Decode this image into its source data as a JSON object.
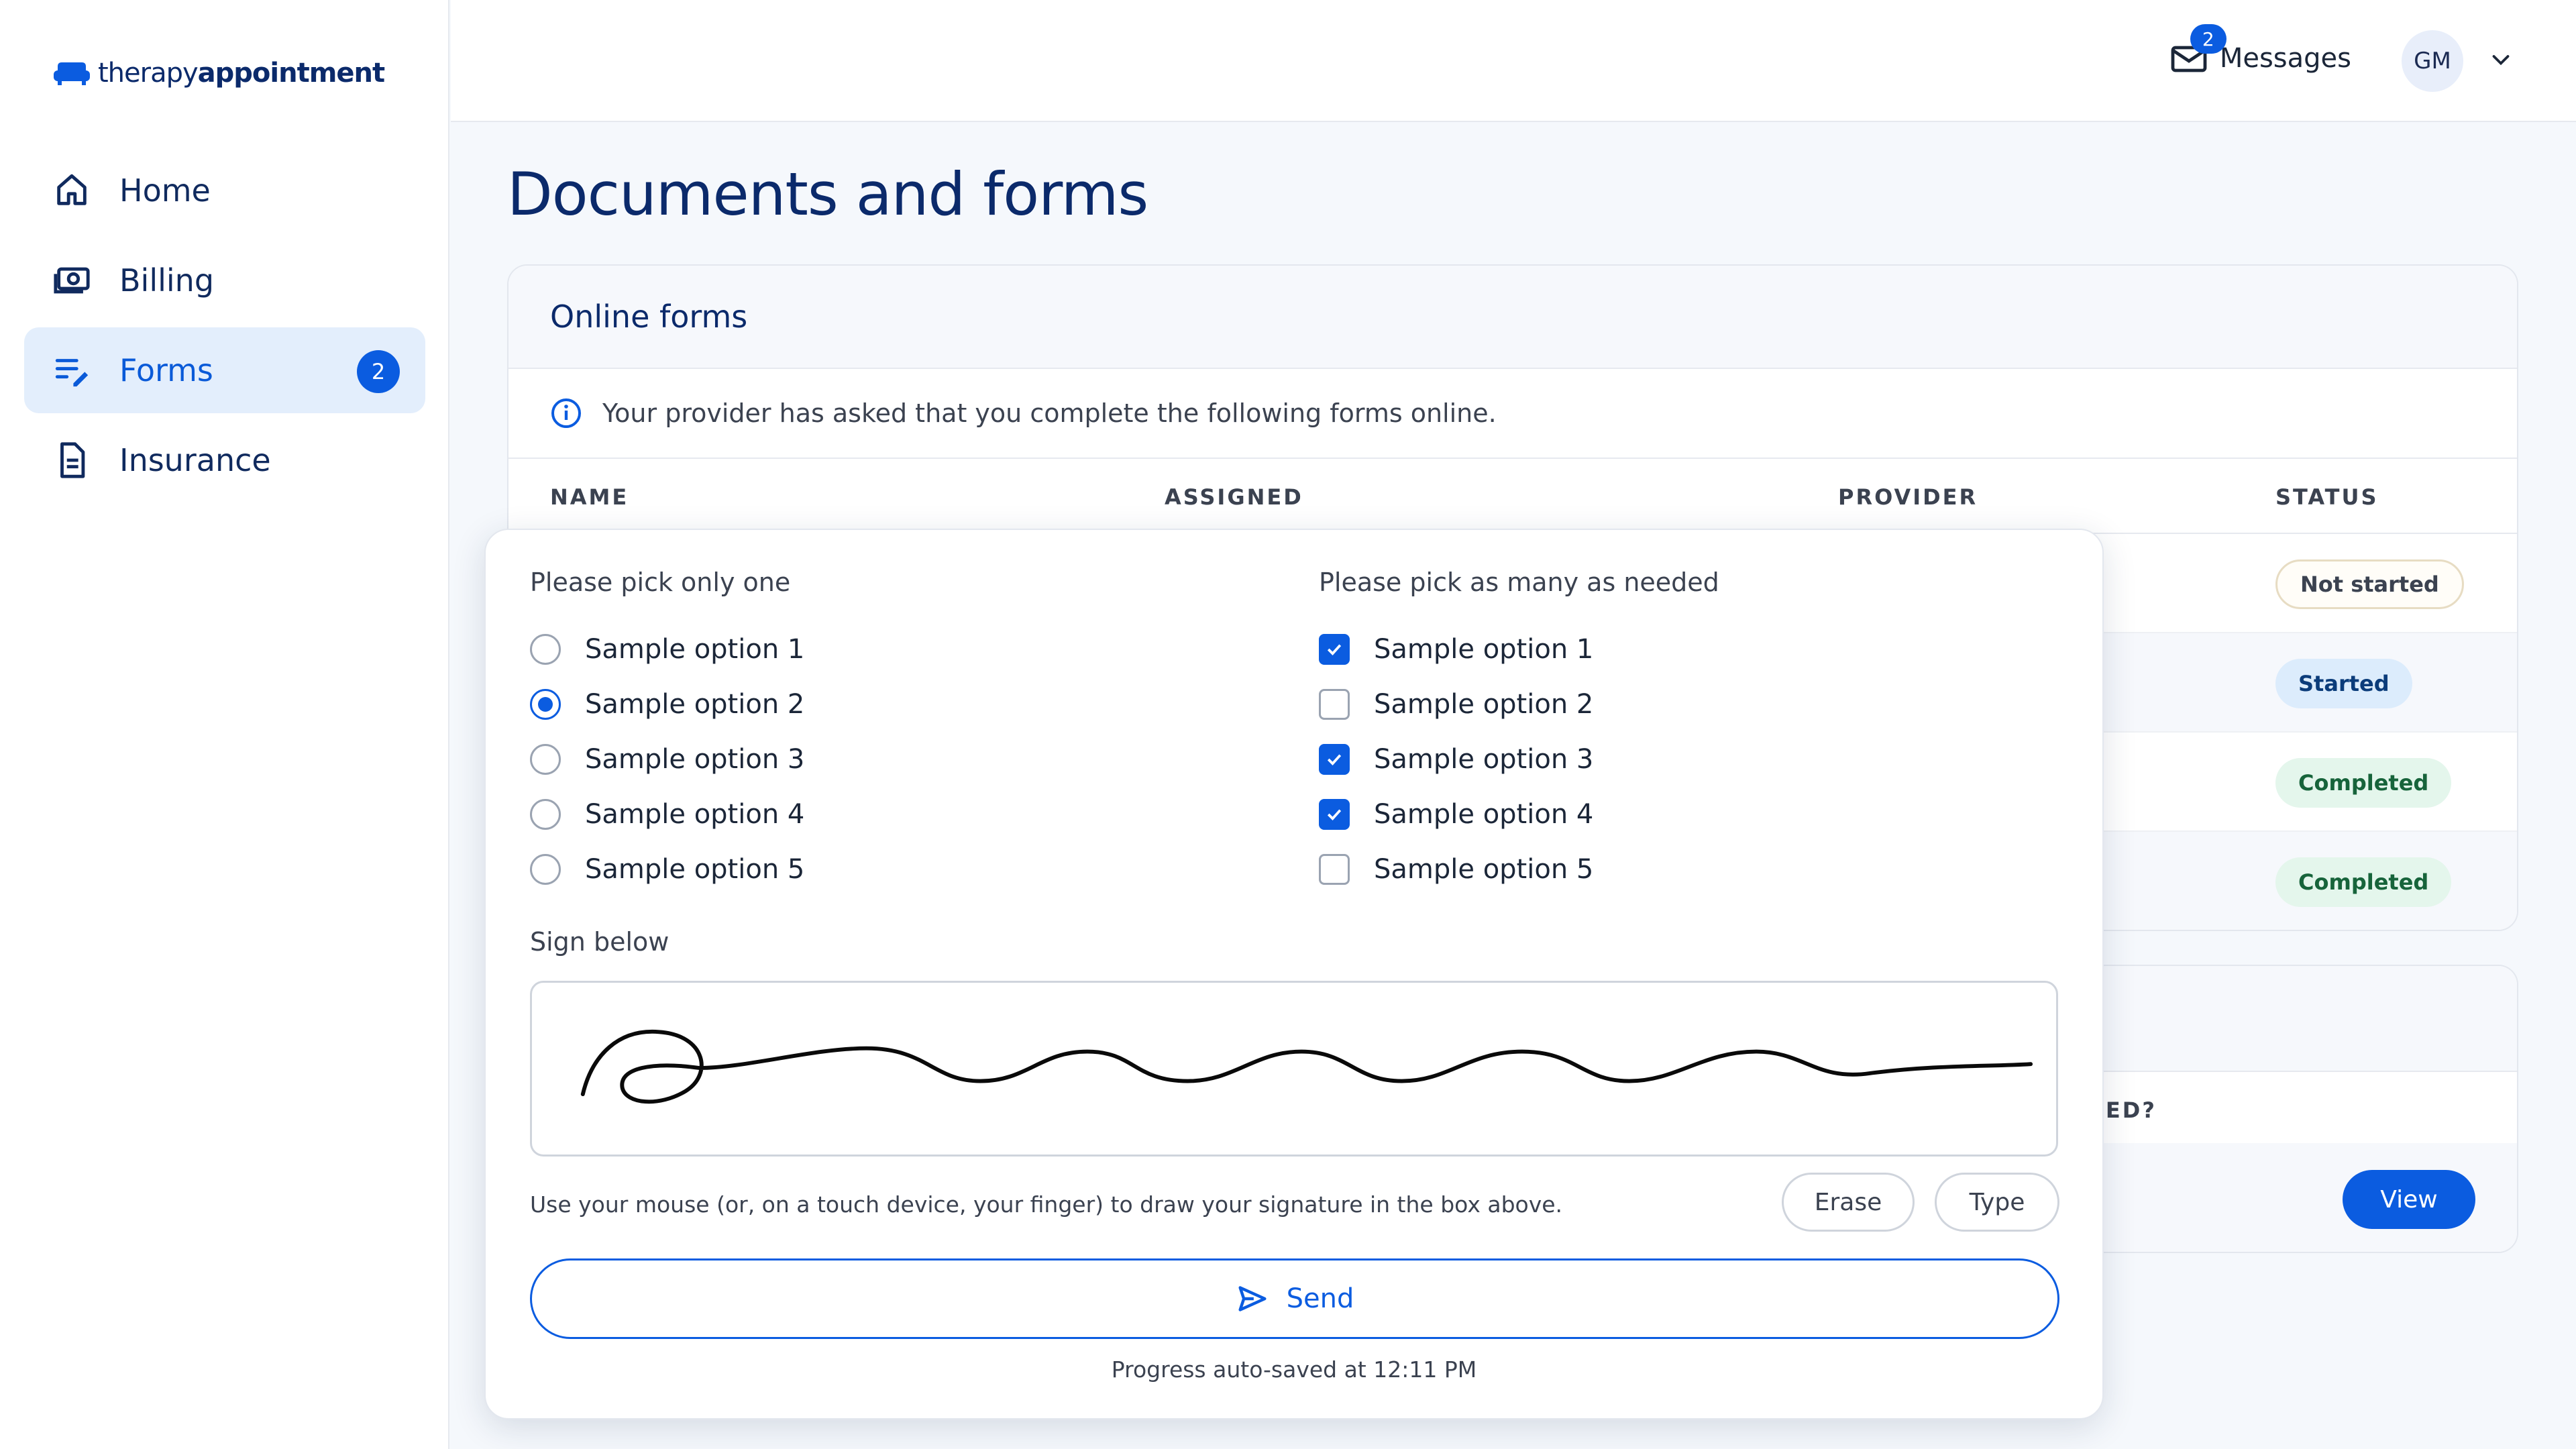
{
  "brand": {
    "logo_light": "therapy",
    "logo_bold": "appointment",
    "accent": "#0b5ce0",
    "navy": "#0b2a6b"
  },
  "sidebar": {
    "items": [
      {
        "label": "Home",
        "icon": "home-icon"
      },
      {
        "label": "Billing",
        "icon": "billing-icon"
      },
      {
        "label": "Forms",
        "icon": "forms-icon",
        "badge": "2",
        "active": true
      },
      {
        "label": "Insurance",
        "icon": "document-icon"
      }
    ]
  },
  "header": {
    "messages_label": "Messages",
    "messages_badge": "2",
    "avatar_initials": "GM"
  },
  "page": {
    "title": "Documents and forms"
  },
  "online_forms": {
    "title": "Online forms",
    "info": "Your provider has asked that you complete the following forms online.",
    "columns": [
      "NAME",
      "ASSIGNED",
      "PROVIDER",
      "STATUS"
    ],
    "statuses": [
      "Not started",
      "Started",
      "Completed",
      "Completed"
    ]
  },
  "documents": {
    "partial_header": "IED?",
    "view_label": "View"
  },
  "modal": {
    "radio_question": "Please pick only one",
    "radio_options": [
      "Sample option 1",
      "Sample option 2",
      "Sample option 3",
      "Sample option 4",
      "Sample option 5"
    ],
    "radio_selected_index": 1,
    "check_question": "Please pick as many as needed",
    "check_options": [
      "Sample option 1",
      "Sample option 2",
      "Sample option 3",
      "Sample option 4",
      "Sample option 5"
    ],
    "check_checked": [
      true,
      false,
      true,
      true,
      false
    ],
    "sign_label": "Sign below",
    "sign_hint": "Use your mouse (or, on a touch device, your finger) to draw your signature in the box above.",
    "erase_label": "Erase",
    "type_label": "Type",
    "send_label": "Send",
    "autosave": "Progress auto-saved at 12:11 PM"
  }
}
